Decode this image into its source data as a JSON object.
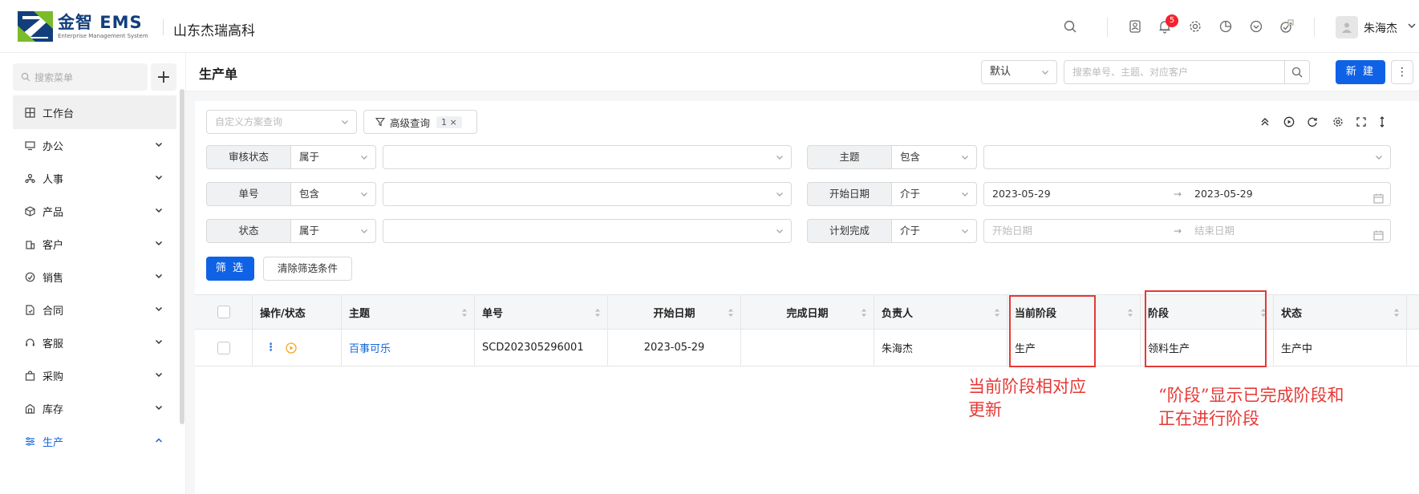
{
  "header": {
    "logo_main": "金智 EMS",
    "logo_sub": "Enterprise Management System",
    "company": "山东杰瑞高科",
    "notification_count": "5",
    "username": "朱海杰"
  },
  "sidebar": {
    "search_placeholder": "搜索菜单",
    "add_label": "+",
    "items": [
      {
        "label": "工作台",
        "icon": "dashboard-icon"
      },
      {
        "label": "办公",
        "icon": "office-icon"
      },
      {
        "label": "人事",
        "icon": "hr-icon"
      },
      {
        "label": "产品",
        "icon": "product-icon"
      },
      {
        "label": "客户",
        "icon": "customer-icon"
      },
      {
        "label": "销售",
        "icon": "sales-icon"
      },
      {
        "label": "合同",
        "icon": "contract-icon"
      },
      {
        "label": "客服",
        "icon": "service-icon"
      },
      {
        "label": "采购",
        "icon": "purchase-icon"
      },
      {
        "label": "库存",
        "icon": "inventory-icon"
      },
      {
        "label": "生产",
        "icon": "production-icon"
      }
    ]
  },
  "toolbar": {
    "page_title": "生产单",
    "view_select": "默认",
    "search_placeholder": "搜索单号、主题、对应客户",
    "new_button": "新 建",
    "more_button": "⋮"
  },
  "filters": {
    "custom_query_placeholder": "自定义方案查询",
    "advanced_query_label": "高级查询",
    "advanced_query_count": "1",
    "rows": [
      {
        "label": "审核状态",
        "op": "属于",
        "value": ""
      },
      {
        "label": "主题",
        "op": "包含",
        "value": ""
      },
      {
        "label": "单号",
        "op": "包含",
        "value": ""
      },
      {
        "label": "开始日期",
        "op": "介于",
        "from": "2023-05-29",
        "to": "2023-05-29"
      },
      {
        "label": "状态",
        "op": "属于",
        "value": ""
      },
      {
        "label": "计划完成",
        "op": "介于",
        "from_placeholder": "开始日期",
        "to_placeholder": "结束日期"
      }
    ],
    "filter_button": "筛 选",
    "clear_button": "清除筛选条件"
  },
  "table": {
    "columns": [
      "操作/状态",
      "主题",
      "单号",
      "开始日期",
      "完成日期",
      "负责人",
      "当前阶段",
      "阶段",
      "状态"
    ],
    "rows": [
      {
        "subject": "百事可乐",
        "number": "SCD202305296001",
        "start_date": "2023-05-29",
        "finish_date": "",
        "owner": "朱海杰",
        "current_stage": "生产",
        "stage": "领料生产",
        "status": "生产中"
      }
    ]
  },
  "annotations": {
    "current_stage_note_line1": "当前阶段相对应",
    "current_stage_note_line2": "更新",
    "stage_note_line1": "“阶段”显示已完成阶段和",
    "stage_note_line2": "正在进行阶段",
    "color": "#e53935"
  },
  "colors": {
    "primary": "#0f62e6",
    "link": "#1668dc",
    "badge": "#f5222d"
  }
}
